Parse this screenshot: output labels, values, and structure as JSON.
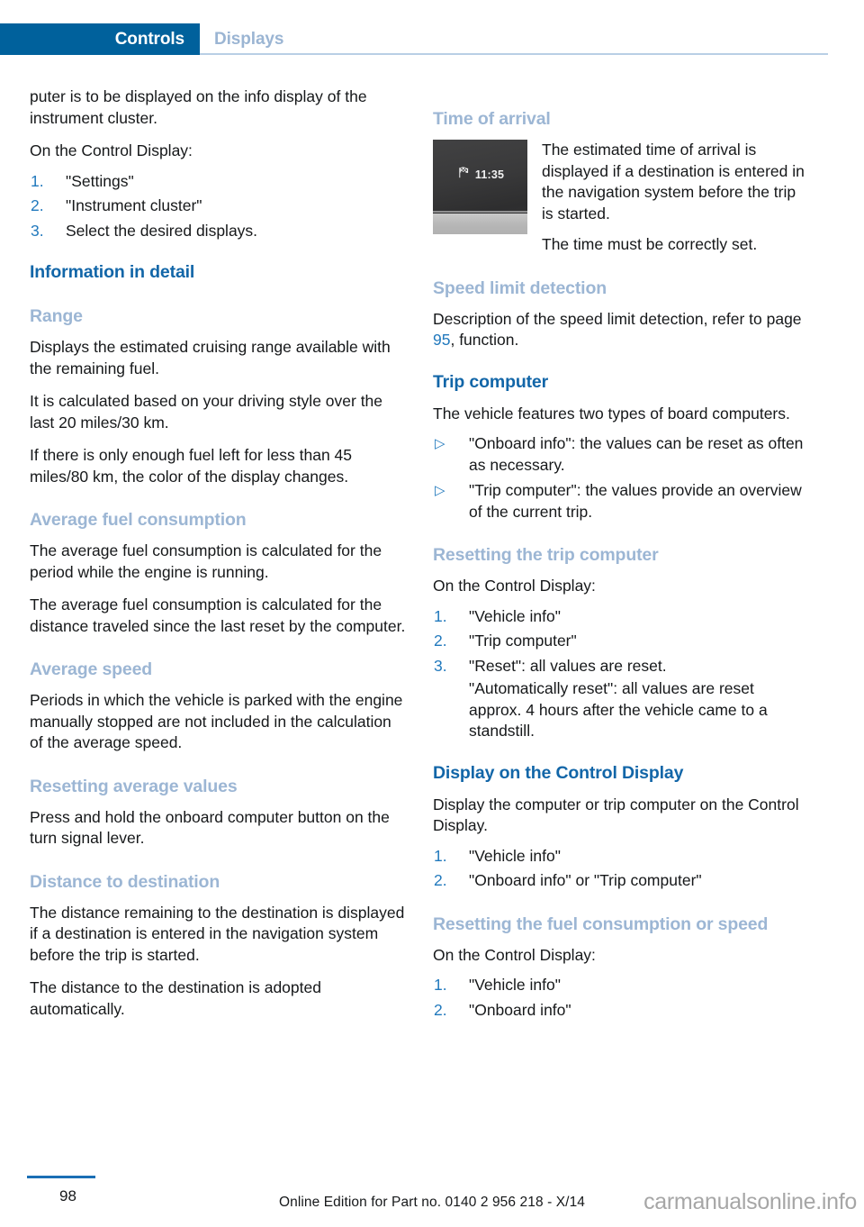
{
  "header": {
    "active_tab": "Controls",
    "inactive_tab": "Displays",
    "active_tab_bg": "#00619c",
    "inactive_tab_color": "#9bb5d3"
  },
  "colors": {
    "heading_strong": "#1266a8",
    "heading_soft": "#9cb6d4",
    "list_marker": "#2179bd",
    "page_ref": "#2179bd",
    "footer_rule": "#1a6fb5",
    "watermark": "#a6a6a6"
  },
  "left_column": {
    "para_continued": "puter is to be displayed on the info display of the instrument cluster.",
    "para_on_control_display": "On the Control Display:",
    "steps_settings": [
      "\"Settings\"",
      "\"Instrument cluster\"",
      "Select the desired displays."
    ],
    "heading_information_in_detail": "Information in detail",
    "heading_range": "Range",
    "range_para_1": "Displays the estimated cruising range available with the remaining fuel.",
    "range_para_2": "It is calculated based on your driving style over the last 20 miles/30 km.",
    "range_para_3": "If there is only enough fuel left for less than 45 miles/80 km, the color of the display changes.",
    "heading_average_fuel_consumption": "Average fuel consumption",
    "afc_para_1": "The average fuel consumption is calculated for the period while the engine is running.",
    "afc_para_2": "The average fuel consumption is calculated for the distance traveled since the last reset by the computer.",
    "heading_average_speed": "Average speed",
    "avgspeed_para_1": "Periods in which the vehicle is parked with the engine manually stopped are not included in the calculation of the average speed.",
    "heading_resetting_average_values": "Resetting average values",
    "rav_para_1": "Press and hold the onboard computer button on the turn signal lever.",
    "heading_distance_to_destination": "Distance to destination",
    "dtd_para_1": "The distance remaining to the destination is displayed if a destination is entered in the navigation system before the trip is started.",
    "dtd_para_2": "The distance to the destination is adopted automatically."
  },
  "right_column": {
    "heading_time_of_arrival": "Time of arrival",
    "figure": {
      "icon": "checkered-flag-icon",
      "time_value": "11:35"
    },
    "toa_para_1": "The estimated time of arrival is displayed if a destination is entered in the navigation system before the trip is started.",
    "toa_para_2": "The time must be correctly set.",
    "heading_speed_limit_detection": "Speed limit detection",
    "sld_para_prefix": "Description of the speed limit detection, refer to page ",
    "sld_page_ref": "95",
    "sld_para_suffix": ", function.",
    "heading_trip_computer": "Trip computer",
    "tc_para_1": "The vehicle features two types of board computers.",
    "tc_bullets": [
      "\"Onboard info\": the values can be reset as often as necessary.",
      "\"Trip computer\": the values provide an overview of the current trip."
    ],
    "heading_resetting_the_trip_computer": "Resetting the trip computer",
    "rtc_para_1": "On the Control Display:",
    "rtc_steps": [
      "\"Vehicle info\"",
      "\"Trip computer\"",
      "\"Reset\": all values are reset."
    ],
    "rtc_step3_sub": "\"Automatically reset\": all values are reset approx. 4 hours after the vehicle came to a standstill.",
    "heading_display_on_the_control_display": "Display on the Control Display",
    "docd_para_1": "Display the computer or trip computer on the Control Display.",
    "docd_steps": [
      "\"Vehicle info\"",
      "\"Onboard info\" or \"Trip computer\""
    ],
    "heading_resetting_fuel_consumption_or_speed": "Resetting the fuel consumption or speed",
    "rfcs_para_1": "On the Control Display:",
    "rfcs_steps": [
      "\"Vehicle info\"",
      "\"Onboard info\""
    ]
  },
  "footer": {
    "page_number": "98",
    "center_text": "Online Edition for Part no. 0140 2 956 218 - X/14",
    "watermark": "carmanualsonline.info"
  }
}
